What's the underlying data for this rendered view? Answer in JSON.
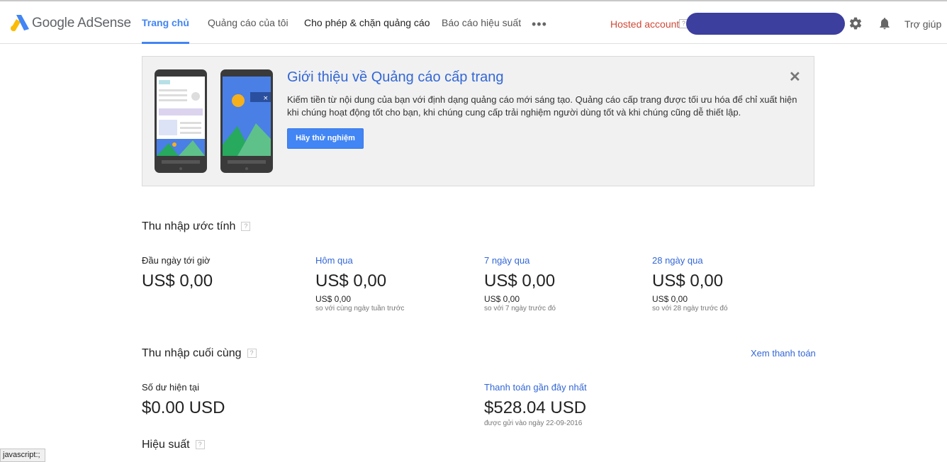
{
  "header": {
    "brand": "Google AdSense",
    "nav": {
      "home": "Trang chủ",
      "my_ads": "Quảng cáo của tôi",
      "allow_block": "Cho phép & chặn quảng cáo",
      "reports": "Báo cáo hiệu suất",
      "more": "•••"
    },
    "hosted_account": "Hosted account",
    "help": "Trợ giúp"
  },
  "banner": {
    "title": "Giới thiệu về Quảng cáo cấp trang",
    "text": "Kiếm tiền từ nội dung của bạn với định dạng quảng cáo mới sáng tạo. Quảng cáo cấp trang được tối ưu hóa để chỉ xuất hiện khi chúng hoạt động tốt cho bạn, khi chúng cung cấp trải nghiệm người dùng tốt và khi chúng cũng dễ thiết lập.",
    "button": "Hãy thử nghiệm",
    "close": "✕"
  },
  "estimated": {
    "title": "Thu nhập ước tính",
    "columns": [
      {
        "label": "Đầu ngày tới giờ",
        "value": "US$ 0,00",
        "compare_value": "",
        "compare_text": ""
      },
      {
        "label": "Hôm qua",
        "value": "US$ 0,00",
        "compare_value": "US$ 0,00",
        "compare_text": "so với cùng ngày tuần trước"
      },
      {
        "label": "7 ngày qua",
        "value": "US$ 0,00",
        "compare_value": "US$ 0,00",
        "compare_text": "so với 7 ngày trước đó"
      },
      {
        "label": "28 ngày qua",
        "value": "US$ 0,00",
        "compare_value": "US$ 0,00",
        "compare_text": "so với 28 ngày trước đó"
      }
    ]
  },
  "finalized": {
    "title": "Thu nhập cuối cùng",
    "view_payments": "Xem thanh toán",
    "balance_label": "Số dư hiện tại",
    "balance_value": "$0.00 USD",
    "last_payment_label": "Thanh toán gần đây nhất",
    "last_payment_value": "$528.04 USD",
    "last_payment_date": "được gửi vào ngày 22-09-2016"
  },
  "performance": {
    "title": "Hiệu suất"
  },
  "status_bar": "javascript:;",
  "colors": {
    "accent": "#4285f4",
    "link": "#3367d6",
    "hosted": "#d14836"
  }
}
